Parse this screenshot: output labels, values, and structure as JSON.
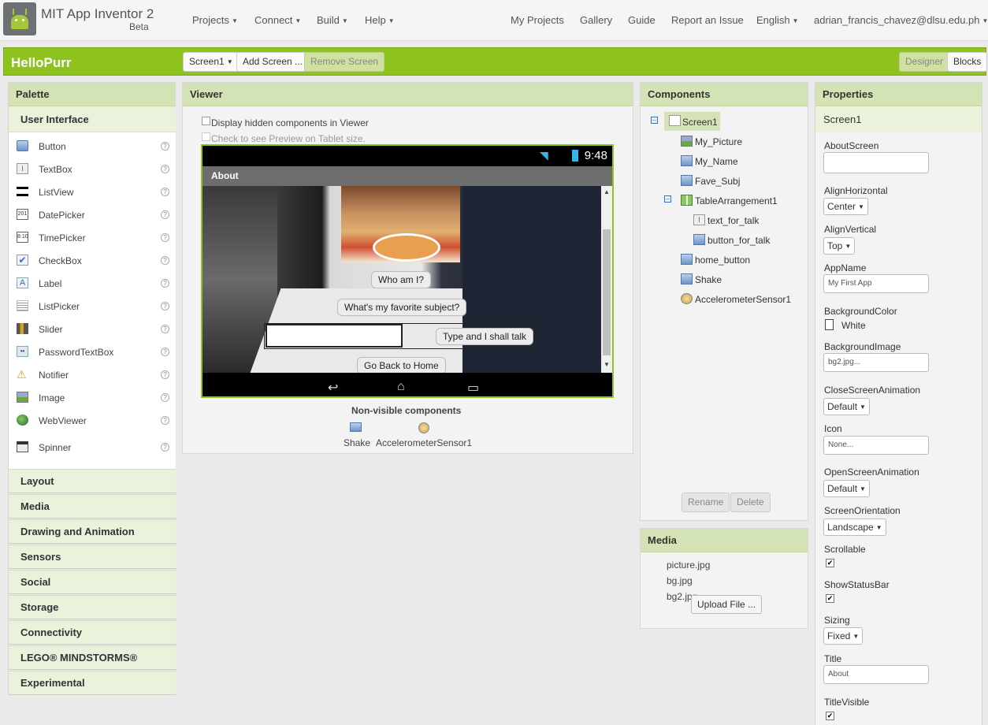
{
  "app": {
    "name": "MIT App Inventor 2",
    "subtitle": "Beta"
  },
  "nav": {
    "left": [
      "Projects",
      "Connect",
      "Build",
      "Help"
    ],
    "right": [
      "My Projects",
      "Gallery",
      "Guide",
      "Report an Issue",
      "English",
      "adrian_francis_chavez@dlsu.edu.ph"
    ]
  },
  "toolbar": {
    "project": "HelloPurr",
    "screen": "Screen1",
    "add_screen": "Add Screen ...",
    "remove_screen": "Remove Screen",
    "designer": "Designer",
    "blocks": "Blocks"
  },
  "palette": {
    "title": "Palette",
    "section": "User Interface",
    "items": [
      "Button",
      "TextBox",
      "ListView",
      "DatePicker",
      "TimePicker",
      "CheckBox",
      "Label",
      "ListPicker",
      "Slider",
      "PasswordTextBox",
      "Notifier",
      "Image",
      "WebViewer",
      "Spinner"
    ],
    "help": "?",
    "categories": [
      "Layout",
      "Media",
      "Drawing and Animation",
      "Sensors",
      "Social",
      "Storage",
      "Connectivity",
      "LEGO® MINDSTORMS®",
      "Experimental"
    ]
  },
  "viewer": {
    "title": "Viewer",
    "hidden_label": "Display hidden components in Viewer",
    "tablet_label": "Check to see Preview on Tablet size.",
    "time": "9:48",
    "screen_title": "About",
    "buttons": {
      "who": "Who am I?",
      "subject": "What's my favorite subject?",
      "talk": "Type and I shall talk",
      "home": "Go Back to Home"
    },
    "nonvisible_title": "Non-visible components",
    "nonvisible": [
      "Shake",
      "AccelerometerSensor1"
    ]
  },
  "components": {
    "title": "Components",
    "tree": [
      "Screen1",
      "My_Picture",
      "My_Name",
      "Fave_Subj",
      "TableArrangement1",
      "text_for_talk",
      "button_for_talk",
      "home_button",
      "Shake",
      "AccelerometerSensor1"
    ],
    "rename": "Rename",
    "delete": "Delete"
  },
  "media": {
    "title": "Media",
    "files": [
      "picture.jpg",
      "bg.jpg",
      "bg2.jpg"
    ],
    "upload": "Upload File ..."
  },
  "properties": {
    "title": "Properties",
    "component": "Screen1",
    "about_screen": {
      "label": "AboutScreen",
      "value": ""
    },
    "align_horizontal": {
      "label": "AlignHorizontal",
      "value": "Center"
    },
    "align_vertical": {
      "label": "AlignVertical",
      "value": "Top"
    },
    "app_name": {
      "label": "AppName",
      "value": "My First App"
    },
    "background_color": {
      "label": "BackgroundColor",
      "value": "White"
    },
    "background_image": {
      "label": "BackgroundImage",
      "value": "bg2.jpg..."
    },
    "close_anim": {
      "label": "CloseScreenAnimation",
      "value": "Default"
    },
    "icon": {
      "label": "Icon",
      "value": "None..."
    },
    "open_anim": {
      "label": "OpenScreenAnimation",
      "value": "Default"
    },
    "orientation": {
      "label": "ScreenOrientation",
      "value": "Landscape"
    },
    "scrollable": {
      "label": "Scrollable",
      "checked": true
    },
    "show_status": {
      "label": "ShowStatusBar",
      "checked": true
    },
    "sizing": {
      "label": "Sizing",
      "value": "Fixed"
    },
    "title_prop": {
      "label": "Title",
      "value": "About"
    },
    "title_visible": {
      "label": "TitleVisible",
      "checked": true
    }
  },
  "colors": {
    "accent": "#8dc21f",
    "panel_head": "#d4e3b5"
  }
}
